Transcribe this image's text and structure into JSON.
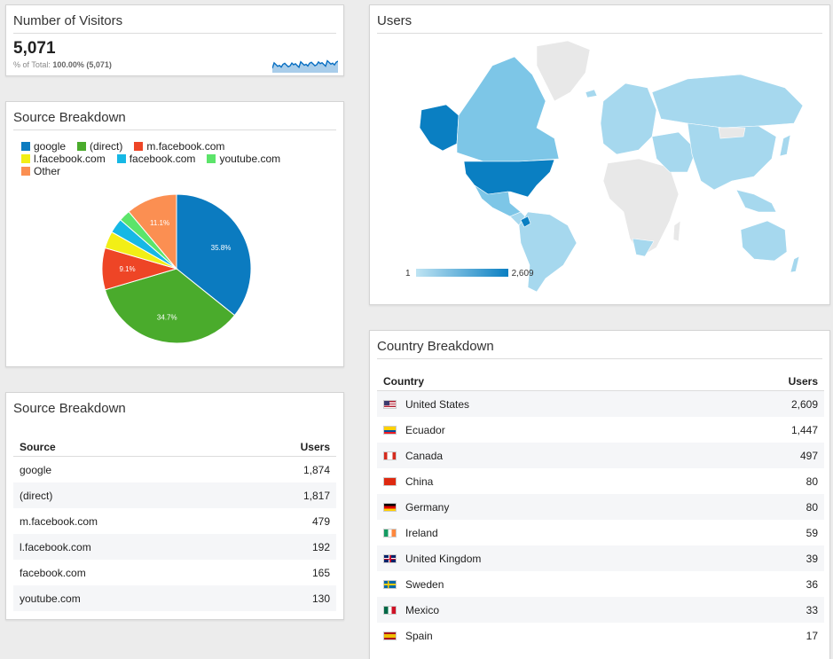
{
  "visitors": {
    "title": "Number of Visitors",
    "value": "5,071",
    "pct_label": "% of Total:",
    "pct_value": "100.00% (5,071)",
    "accent": "#0a6fc2"
  },
  "source_pie": {
    "title": "Source Breakdown",
    "legend": [
      {
        "label": "google",
        "color": "#0b7bc0"
      },
      {
        "label": "(direct)",
        "color": "#4aab2c"
      },
      {
        "label": "m.facebook.com",
        "color": "#ee4526"
      },
      {
        "label": "l.facebook.com",
        "color": "#f2ef16"
      },
      {
        "label": "facebook.com",
        "color": "#16b8e5"
      },
      {
        "label": "youtube.com",
        "color": "#5ce46a"
      },
      {
        "label": "Other",
        "color": "#fb8f52"
      }
    ]
  },
  "chart_data": {
    "type": "pie",
    "categories": [
      "google",
      "(direct)",
      "m.facebook.com",
      "l.facebook.com",
      "facebook.com",
      "youtube.com",
      "Other"
    ],
    "values": [
      35.8,
      34.7,
      9.1,
      3.7,
      3.2,
      2.5,
      11.1
    ],
    "labels": [
      "35.8%",
      "34.7%",
      "9.1%",
      "",
      "",
      "",
      "11.1%"
    ],
    "colors": [
      "#0b7bc0",
      "#4aab2c",
      "#ee4526",
      "#f2ef16",
      "#16b8e5",
      "#5ce46a",
      "#fb8f52"
    ],
    "title": "Source Breakdown"
  },
  "source_table": {
    "title": "Source Breakdown",
    "headers": [
      "Source",
      "Users"
    ],
    "rows": [
      [
        "google",
        "1,874"
      ],
      [
        "(direct)",
        "1,817"
      ],
      [
        "m.facebook.com",
        "479"
      ],
      [
        "l.facebook.com",
        "192"
      ],
      [
        "facebook.com",
        "165"
      ],
      [
        "youtube.com",
        "130"
      ]
    ]
  },
  "map": {
    "title": "Users",
    "legend_min": "1",
    "legend_max": "2,609",
    "color_low": "#bfe4f3",
    "color_high": "#0a7fc2",
    "color_nodata": "#e8e8e8"
  },
  "country_table": {
    "title": "Country Breakdown",
    "headers": [
      "Country",
      "Users"
    ],
    "rows": [
      {
        "flag": "us-flag-icon",
        "country": "United States",
        "users": "2,609"
      },
      {
        "flag": "ec-flag-icon",
        "country": "Ecuador",
        "users": "1,447"
      },
      {
        "flag": "ca-flag-icon",
        "country": "Canada",
        "users": "497"
      },
      {
        "flag": "cn-flag-icon",
        "country": "China",
        "users": "80"
      },
      {
        "flag": "de-flag-icon",
        "country": "Germany",
        "users": "80"
      },
      {
        "flag": "ie-flag-icon",
        "country": "Ireland",
        "users": "59"
      },
      {
        "flag": "gb-flag-icon",
        "country": "United Kingdom",
        "users": "39"
      },
      {
        "flag": "se-flag-icon",
        "country": "Sweden",
        "users": "36"
      },
      {
        "flag": "mx-flag-icon",
        "country": "Mexico",
        "users": "33"
      },
      {
        "flag": "es-flag-icon",
        "country": "Spain",
        "users": "17"
      }
    ]
  }
}
